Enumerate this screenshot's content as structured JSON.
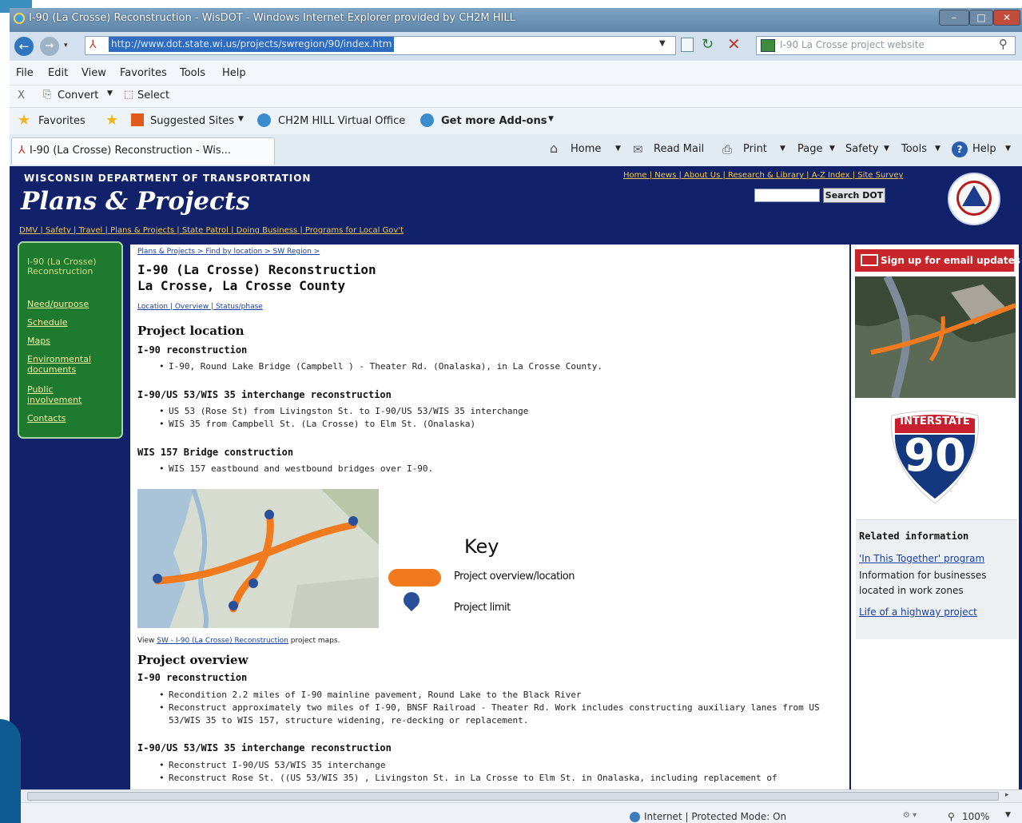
{
  "window": {
    "title": "I-90 (La Crosse) Reconstruction - WisDOT - Windows Internet Explorer provided by CH2M HILL",
    "url": "http://www.dot.state.wi.us/projects/swregion/90/index.htm",
    "search_text": "I-90 La Crosse project website",
    "menu": [
      "File",
      "Edit",
      "View",
      "Favorites",
      "Tools",
      "Help"
    ],
    "cmd_close": "X",
    "convert_label": "Convert",
    "select_label": "Select",
    "favorites_label": "Favorites",
    "suggested_sites": "Suggested Sites",
    "virtual_office": "CH2M HILL Virtual Office",
    "addons": "Get more Add-ons",
    "tab_title": "I-90 (La Crosse) Reconstruction - Wis...",
    "toolbar": {
      "home": "Home",
      "read_mail": "Read Mail",
      "print": "Print",
      "page": "Page",
      "safety": "Safety",
      "tools": "Tools",
      "help": "Help"
    }
  },
  "header": {
    "subtitle": "WISCONSIN DEPARTMENT OF TRANSPORTATION",
    "title": "Plans & Projects",
    "top_links": "Home | News | About Us | Research & Library | A-Z Index | Site Survey",
    "search_button": "Search DOT",
    "nav_links": "DMV | Safety | Travel | Plans & Projects | State Patrol | Doing Business | Programs for Local Gov't"
  },
  "left_nav": {
    "current": "I-90 (La Crosse) Reconstruction",
    "items": [
      "Need/purpose",
      "Schedule",
      "Maps",
      "Environmental documents",
      "Public involvement",
      "Contacts"
    ]
  },
  "content": {
    "breadcrumb": "Plans & Projects > Find by location > SW Region >",
    "title_line1": "I-90 (La Crosse) Reconstruction",
    "title_line2": "La Crosse, La Crosse County",
    "jump_links": "Location | Overview | Status/phase",
    "location_heading": "Project location",
    "loc_sub1": "I-90 reconstruction",
    "loc_sub1_items": [
      "I-90, Round Lake Bridge (Campbell ) - Theater Rd. (Onalaska), in La Crosse County."
    ],
    "loc_sub2": "I-90/US 53/WIS 35 interchange reconstruction",
    "loc_sub2_items": [
      "US 53 (Rose St) from Livingston St. to I-90/US 53/WIS 35 interchange",
      "WIS 35 from Campbell St. (La Crosse) to Elm St. (Onalaska)"
    ],
    "loc_sub3": "WIS 157 Bridge construction",
    "loc_sub3_items": [
      "WIS 157 eastbound and westbound bridges over I-90."
    ],
    "key_title": "Key",
    "key_overview": "Project overview/location",
    "key_limit": "Project limit",
    "map_caption_pre": "View",
    "map_caption_link": "SW - I-90 (La Crosse) Reconstruction",
    "map_caption_post": "project maps.",
    "overview_heading": "Project overview",
    "ov_sub1": "I-90 reconstruction",
    "ov_sub1_items": [
      "Recondition 2.2 miles of I-90 mainline pavement, Round Lake to the Black River",
      "Reconstruct approximately two miles of I-90, BNSF Railroad - Theater Rd. Work includes constructing auxiliary lanes from US",
      "53/WIS 35 to WIS 157, structure widening, re-decking or replacement."
    ],
    "ov_sub2": "I-90/US 53/WIS 35 interchange reconstruction",
    "ov_sub2_items": [
      "Reconstruct I-90/US 53/WIS 35 interchange",
      "Reconstruct Rose St. ((US 53/WIS 35) , Livingston St. in La Crosse to Elm St. in Onalaska, including replacement of"
    ]
  },
  "sidebar": {
    "email": "Sign up for email updates",
    "shield_top": "INTERSTATE",
    "shield_num": "90",
    "related_title": "Related information",
    "related_link1": "'In This Together' program",
    "related_text": "Information for businesses located in work zones",
    "related_link2": "Life of a highway project"
  },
  "status": {
    "zone": "Internet | Protected Mode: On",
    "zoom": "100%"
  },
  "colors": {
    "page_bg": "#11226a",
    "nav_green": "#1d7a2f",
    "link": "#1a3fa6",
    "route_orange": "#f07a1d",
    "email_red": "#c8252b",
    "shield_blue": "#14387f",
    "shield_red": "#c8202f"
  }
}
